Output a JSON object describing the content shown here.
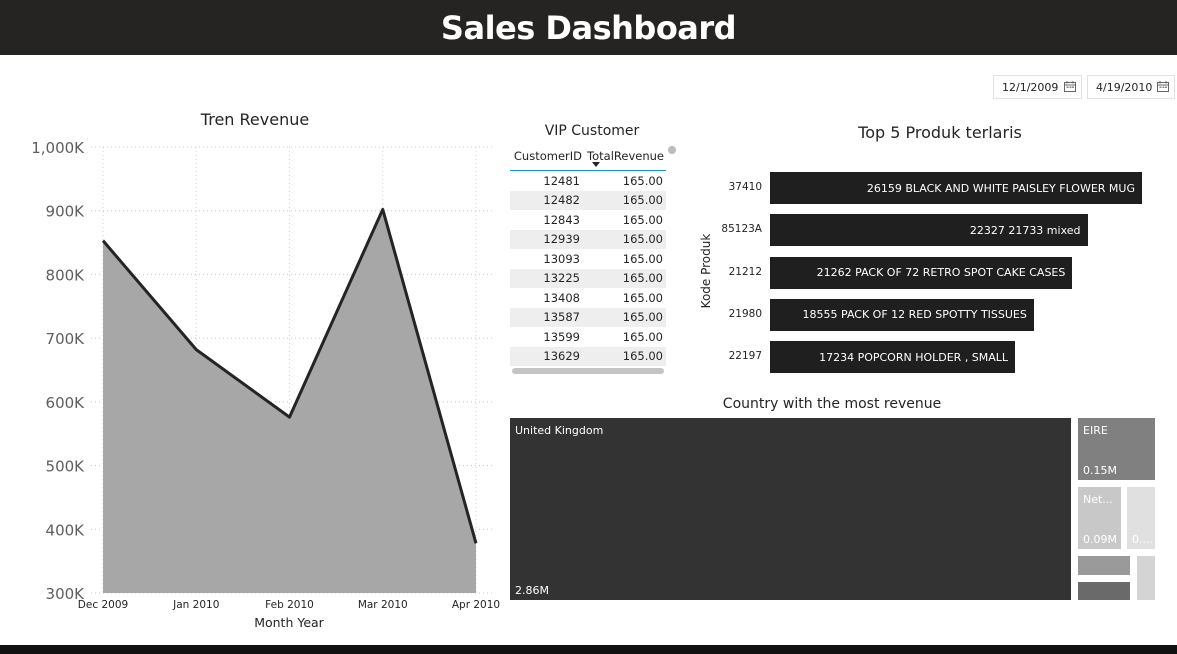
{
  "header": {
    "title": "Sales Dashboard"
  },
  "date_range": {
    "start": "12/1/2009",
    "end": "4/19/2010"
  },
  "trend": {
    "title": "Tren Revenue"
  },
  "vip": {
    "title": "VIP Customer",
    "col_customer": "CustomerID",
    "col_revenue": "TotalRevenue",
    "rows": [
      {
        "id": "12481",
        "rev": "165.00"
      },
      {
        "id": "12482",
        "rev": "165.00"
      },
      {
        "id": "12843",
        "rev": "165.00"
      },
      {
        "id": "12939",
        "rev": "165.00"
      },
      {
        "id": "13093",
        "rev": "165.00"
      },
      {
        "id": "13225",
        "rev": "165.00"
      },
      {
        "id": "13408",
        "rev": "165.00"
      },
      {
        "id": "13587",
        "rev": "165.00"
      },
      {
        "id": "13599",
        "rev": "165.00"
      },
      {
        "id": "13629",
        "rev": "165.00"
      }
    ]
  },
  "top5": {
    "title": "Top 5 Produk terlaris",
    "ylabel": "Kode Produk",
    "items": [
      {
        "code": "37410",
        "label": "26159 BLACK AND WHITE PAISLEY FLOWER MUG",
        "value": 26159
      },
      {
        "code": "85123A",
        "label": "22327 21733 mixed",
        "value": 22327
      },
      {
        "code": "21212",
        "label": "21262 PACK OF 72 RETRO SPOT CAKE CASES",
        "value": 21262
      },
      {
        "code": "21980",
        "label": "18555 PACK OF 12 RED SPOTTY TISSUES",
        "value": 18555
      },
      {
        "code": "22197",
        "label": "17234 POPCORN HOLDER , SMALL",
        "value": 17234
      }
    ]
  },
  "country": {
    "title": "Country with the most revenue",
    "cells": [
      {
        "name": "United Kingdom",
        "value": "2.86M",
        "color": "#333333"
      },
      {
        "name": "EIRE",
        "value": "0.15M",
        "color": "#808080"
      },
      {
        "name": "Net...",
        "value": "0.09M",
        "color": "#c8c8c8"
      },
      {
        "name": "",
        "value": "0....",
        "color": "#e0e0e0"
      },
      {
        "name": "",
        "value": "",
        "color": "#9a9a9a"
      },
      {
        "name": "",
        "value": "",
        "color": "#6a6a6a"
      },
      {
        "name": "",
        "value": "",
        "color": "#d4d4d4"
      }
    ]
  },
  "chart_data": [
    {
      "type": "area",
      "title": "Tren Revenue",
      "xlabel": "Month Year",
      "ylabel": "",
      "categories": [
        "Dec 2009",
        "Jan 2010",
        "Feb 2010",
        "Mar 2010",
        "Apr 2010"
      ],
      "values": [
        853000,
        682000,
        576000,
        902000,
        378000
      ],
      "ylim": [
        300000,
        1000000
      ],
      "yticks": [
        "1,000K",
        "900K",
        "800K",
        "700K",
        "600K",
        "500K",
        "400K",
        "300K"
      ],
      "grid": true,
      "fill_color": "#a8a7a8",
      "line_color": "#252423"
    },
    {
      "type": "bar",
      "title": "Top 5 Produk terlaris",
      "ylabel": "Kode Produk",
      "categories": [
        "37410",
        "85123A",
        "21212",
        "21980",
        "22197"
      ],
      "values": [
        26159,
        22327,
        21262,
        18555,
        17234
      ]
    }
  ]
}
